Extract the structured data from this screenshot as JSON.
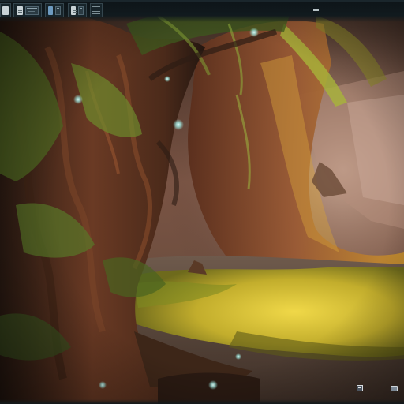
{
  "wallpaper": {
    "subject": "fantasy-forest-painting",
    "colors": {
      "shadow": "#1d1813",
      "bark": "#5a3420",
      "moss": "#5e7a28",
      "flowers": "#d8c23a",
      "mist": "#b89a88",
      "glow": "#9fe8e0"
    }
  },
  "taskbar": {
    "windows": [
      {
        "icon": "app-icon"
      },
      {
        "icon": "document-window-icon"
      },
      {
        "icon": "browser-window-icon"
      },
      {
        "icon": "file-window-icon"
      },
      {
        "icon": "list-window-icon"
      }
    ]
  },
  "tray": {
    "icons": [
      "monitor-icon",
      "network-icon"
    ]
  }
}
